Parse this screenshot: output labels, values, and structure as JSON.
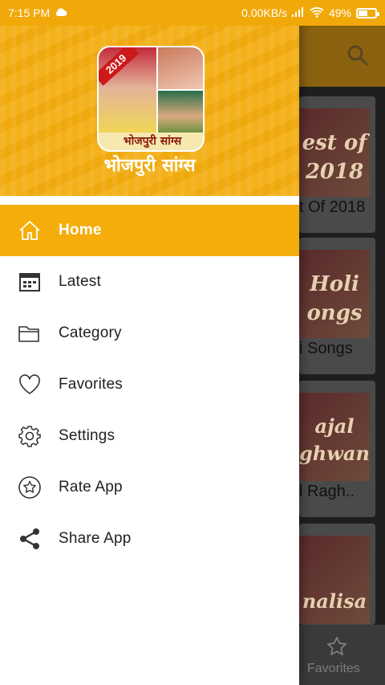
{
  "status": {
    "time": "7:15 PM",
    "net_speed": "0.00KB/s",
    "battery": "49%",
    "battery_level": 0.49
  },
  "drawer": {
    "logo_year": "2019",
    "logo_caption": "भोजपुरी सांग्स",
    "app_title": "भोजपुरी सांग्स",
    "items": [
      {
        "label": "Home",
        "icon": "home-icon",
        "active": true
      },
      {
        "label": "Latest",
        "icon": "calendar-icon"
      },
      {
        "label": "Category",
        "icon": "folder-icon"
      },
      {
        "label": "Favorites",
        "icon": "heart-icon"
      },
      {
        "label": "Settings",
        "icon": "gear-icon"
      },
      {
        "label": "Rate App",
        "icon": "star-icon"
      },
      {
        "label": "Share App",
        "icon": "share-icon"
      }
    ]
  },
  "background": {
    "cards": [
      {
        "thumb_text": "est of 2018",
        "caption": "t Of 2018"
      },
      {
        "thumb_text": "Holi ongs",
        "caption": "i Songs"
      },
      {
        "thumb_text": "ajal ghwani",
        "caption": "l Ragh.."
      },
      {
        "thumb_text": "nalisa",
        "caption": ""
      }
    ],
    "bottom_nav_label": "Favorites"
  },
  "colors": {
    "accent": "#f4ad0a",
    "status_bar": "#f1a90a"
  }
}
